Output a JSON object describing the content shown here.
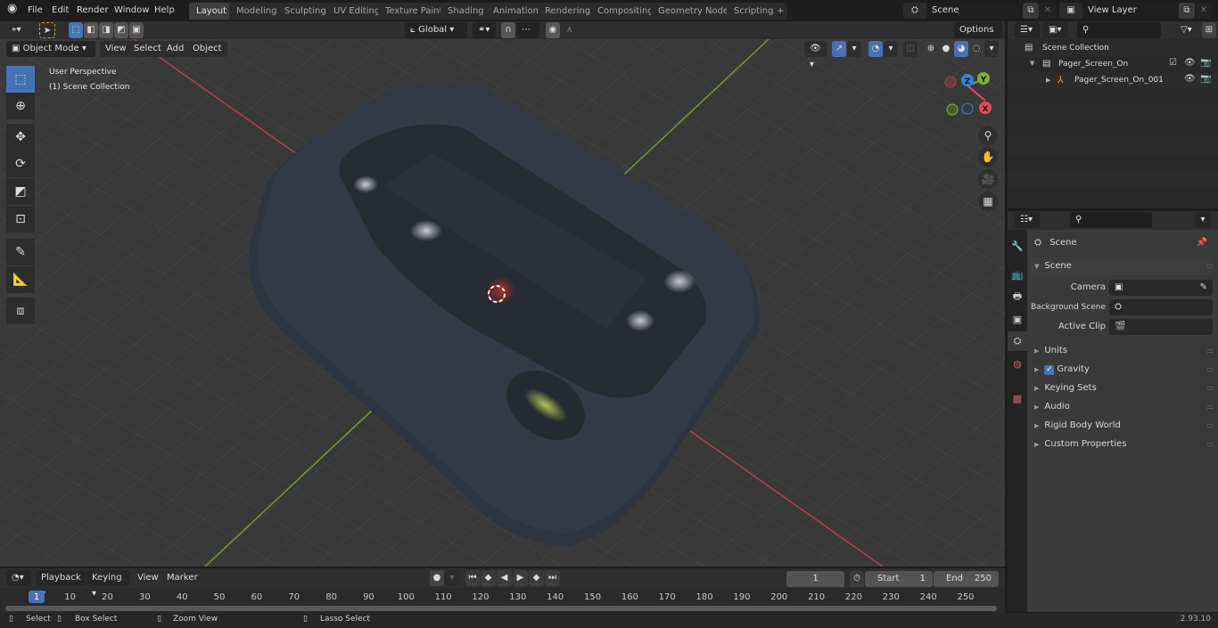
{
  "app": {
    "name": "Blender",
    "version": "2.93.10"
  },
  "menu": [
    "File",
    "Edit",
    "Render",
    "Window",
    "Help"
  ],
  "workspace_tabs": [
    {
      "label": "Layout",
      "active": true
    },
    {
      "label": "Modeling"
    },
    {
      "label": "Sculpting"
    },
    {
      "label": "UV Editing"
    },
    {
      "label": "Texture Paint"
    },
    {
      "label": "Shading"
    },
    {
      "label": "Animation"
    },
    {
      "label": "Rendering"
    },
    {
      "label": "Compositing"
    },
    {
      "label": "Geometry Nodes"
    },
    {
      "label": "Scripting"
    }
  ],
  "add_workspace": "+",
  "scene_selector": {
    "value": "Scene"
  },
  "view_layer_selector": {
    "value": "View Layer"
  },
  "viewport": {
    "mode": "Object Mode",
    "menus": [
      "View",
      "Select",
      "Add",
      "Object"
    ],
    "transform_orientation": "Global",
    "options_label": "Options",
    "overlay_text": [
      "User Perspective",
      "(1) Scene Collection"
    ],
    "gizmo_axes": {
      "x": "X",
      "y": "Y",
      "z": "Z"
    },
    "colors": {
      "x_axis": "#e84a5a",
      "y_axis": "#7fae3b",
      "z_axis": "#2f83e0",
      "active_tool": "#4772b3"
    },
    "tools": [
      "select-box",
      "cursor",
      "move",
      "rotate",
      "scale",
      "transform",
      "annotate",
      "measure",
      "add-cube"
    ],
    "nav_buttons": [
      "zoom",
      "pan",
      "camera",
      "perspective-toggle"
    ]
  },
  "outliner": {
    "root": "Scene Collection",
    "items": [
      {
        "label": "Pager_Screen_On",
        "type": "collection",
        "expanded": true,
        "checked": true
      },
      {
        "label": "Pager_Screen_On_001",
        "type": "armature",
        "expanded": false
      }
    ]
  },
  "properties": {
    "context_title": "Scene",
    "section": "Scene",
    "fields": [
      {
        "label": "Camera",
        "value": ""
      },
      {
        "label": "Background Scene",
        "value": ""
      },
      {
        "label": "Active Clip",
        "value": ""
      }
    ],
    "panels": [
      {
        "label": "Units"
      },
      {
        "label": "Gravity",
        "checkbox": true
      },
      {
        "label": "Keying Sets"
      },
      {
        "label": "Audio"
      },
      {
        "label": "Rigid Body World"
      },
      {
        "label": "Custom Properties"
      }
    ],
    "tabs": [
      "tool",
      "render",
      "output",
      "view-layer",
      "scene",
      "world",
      "texture"
    ]
  },
  "timeline": {
    "menus": [
      "Playback",
      "Keying",
      "View",
      "Marker"
    ],
    "current_frame": "1",
    "start_label": "Start",
    "start": "1",
    "end_label": "End",
    "end": "250",
    "ticks": [
      "1",
      "10",
      "20",
      "30",
      "40",
      "50",
      "60",
      "70",
      "80",
      "90",
      "100",
      "110",
      "120",
      "130",
      "140",
      "150",
      "160",
      "170",
      "180",
      "190",
      "200",
      "210",
      "220",
      "230",
      "240",
      "250"
    ]
  },
  "statusbar": {
    "hints": [
      "Select",
      "Box Select",
      "Zoom View",
      "Lasso Select"
    ],
    "version": "2.93.10"
  }
}
